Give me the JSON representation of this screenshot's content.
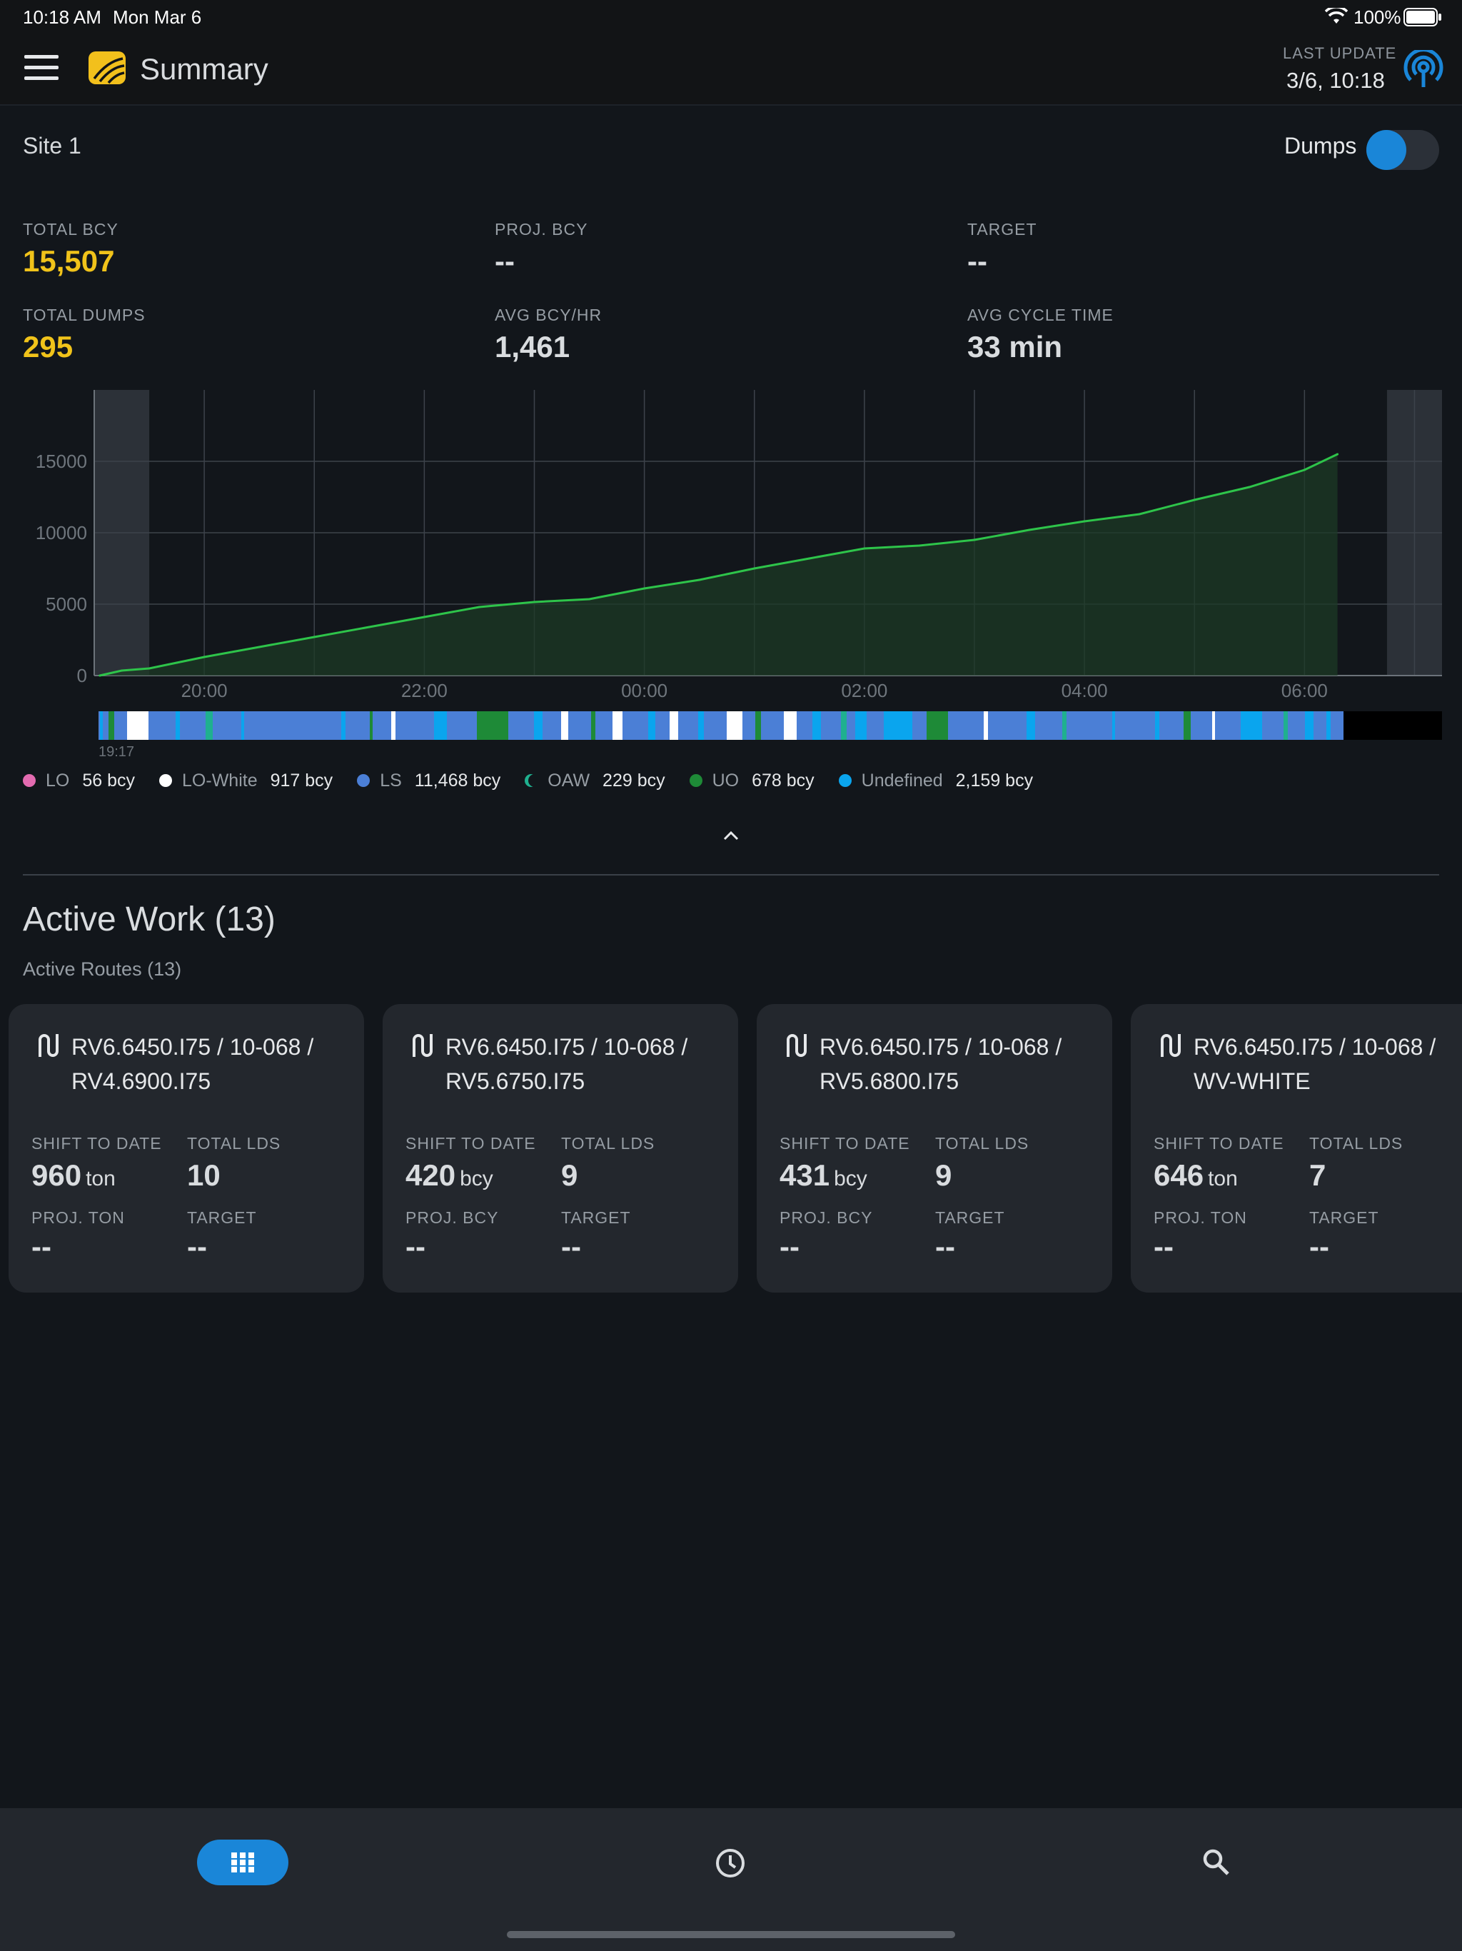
{
  "status_bar": {
    "time": "10:18 AM",
    "date": "Mon Mar 6",
    "battery": "100%"
  },
  "app_bar": {
    "title": "Summary",
    "last_update_label": "LAST UPDATE",
    "last_update_value": "3/6, 10:18"
  },
  "site": {
    "name": "Site 1",
    "dumps_toggle_label": "Dumps",
    "dumps_toggle_on": true
  },
  "metrics": [
    {
      "label": "TOTAL BCY",
      "value": "15,507",
      "highlight": true
    },
    {
      "label": "PROJ. BCY",
      "value": "--",
      "highlight": false
    },
    {
      "label": "TARGET",
      "value": "--",
      "highlight": false
    },
    {
      "label": "TOTAL DUMPS",
      "value": "295",
      "highlight": true
    },
    {
      "label": "AVG BCY/HR",
      "value": "1,461",
      "highlight": false
    },
    {
      "label": "AVG CYCLE TIME",
      "value": "33 min",
      "highlight": false
    }
  ],
  "chart_data": {
    "type": "area",
    "title": "",
    "xlabel": "",
    "ylabel": "",
    "x_ticks": [
      "20:00",
      "22:00",
      "00:00",
      "02:00",
      "04:00",
      "06:00"
    ],
    "y_ticks": [
      "0",
      "5000",
      "10000",
      "15000"
    ],
    "ylim": [
      0,
      20000
    ],
    "xlim_hours": [
      19.0,
      31.25
    ],
    "shaded_regions_hours": [
      [
        19.0,
        19.5
      ],
      [
        30.75,
        31.25
      ]
    ],
    "grid": true,
    "series": [
      {
        "color": "#2ec44a",
        "x_hours": [
          19.05,
          19.25,
          19.5,
          19.75,
          20.0,
          20.5,
          21.0,
          21.5,
          22.0,
          22.5,
          23.0,
          23.5,
          24.0,
          24.5,
          25.0,
          25.5,
          26.0,
          26.5,
          27.0,
          27.5,
          28.0,
          28.5,
          29.0,
          29.5,
          30.0,
          30.3
        ],
        "values": [
          0,
          350,
          500,
          900,
          1300,
          2000,
          2700,
          3400,
          4100,
          4800,
          5150,
          5350,
          6100,
          6700,
          7500,
          8200,
          8900,
          9100,
          9500,
          10200,
          10800,
          11300,
          12300,
          13200,
          14400,
          15500
        ]
      }
    ],
    "strip_start_label": "19:17",
    "legend": [
      {
        "name": "LO",
        "value": "56 bcy",
        "color": "#e36bb0",
        "icon": "flower-dot-icon"
      },
      {
        "name": "LO-White",
        "value": "917 bcy",
        "color": "#ffffff",
        "icon": "dot-icon"
      },
      {
        "name": "LS",
        "value": "11,468 bcy",
        "color": "#4b7fd6",
        "icon": "dot-icon"
      },
      {
        "name": "OAW",
        "value": "229 bcy",
        "color": "#1fb08f",
        "icon": "crescent-icon"
      },
      {
        "name": "UO",
        "value": "678 bcy",
        "color": "#1e8a37",
        "icon": "dot-icon"
      },
      {
        "name": "Undefined",
        "value": "2,159 bcy",
        "color": "#0aa5ee",
        "icon": "dot-icon"
      }
    ]
  },
  "active_work": {
    "title": "Active Work (13)",
    "routes_label": "Active Routes (13)"
  },
  "routes": [
    {
      "line1": "RV6.6450.I75 / 10-068 /",
      "line2": "RV4.6900.I75",
      "std_label": "SHIFT TO DATE",
      "std_value": "960",
      "std_unit": "ton",
      "lds_label": "TOTAL LDS",
      "lds_value": "10",
      "proj_label": "PROJ. TON",
      "proj_value": "--",
      "target_label": "TARGET",
      "target_value": "--"
    },
    {
      "line1": "RV6.6450.I75 / 10-068 /",
      "line2": "RV5.6750.I75",
      "std_label": "SHIFT TO DATE",
      "std_value": "420",
      "std_unit": "bcy",
      "lds_label": "TOTAL LDS",
      "lds_value": "9",
      "proj_label": "PROJ. BCY",
      "proj_value": "--",
      "target_label": "TARGET",
      "target_value": "--"
    },
    {
      "line1": "RV6.6450.I75 / 10-068 /",
      "line2": "RV5.6800.I75",
      "std_label": "SHIFT TO DATE",
      "std_value": "431",
      "std_unit": "bcy",
      "lds_label": "TOTAL LDS",
      "lds_value": "9",
      "proj_label": "PROJ. BCY",
      "proj_value": "--",
      "target_label": "TARGET",
      "target_value": "--"
    },
    {
      "line1": "RV6.6450.I75 / 10-068 /",
      "line2": "WV-WHITE",
      "std_label": "SHIFT TO DATE",
      "std_value": "646",
      "std_unit": "ton",
      "lds_label": "TOTAL LDS",
      "lds_value": "7",
      "proj_label": "PROJ. TON",
      "proj_value": "--",
      "target_label": "TARGET",
      "target_value": "--"
    }
  ],
  "bottom_nav": [
    {
      "icon": "grid-icon",
      "active": true
    },
    {
      "icon": "clock-icon",
      "active": false
    },
    {
      "icon": "search-icon",
      "active": false
    }
  ]
}
